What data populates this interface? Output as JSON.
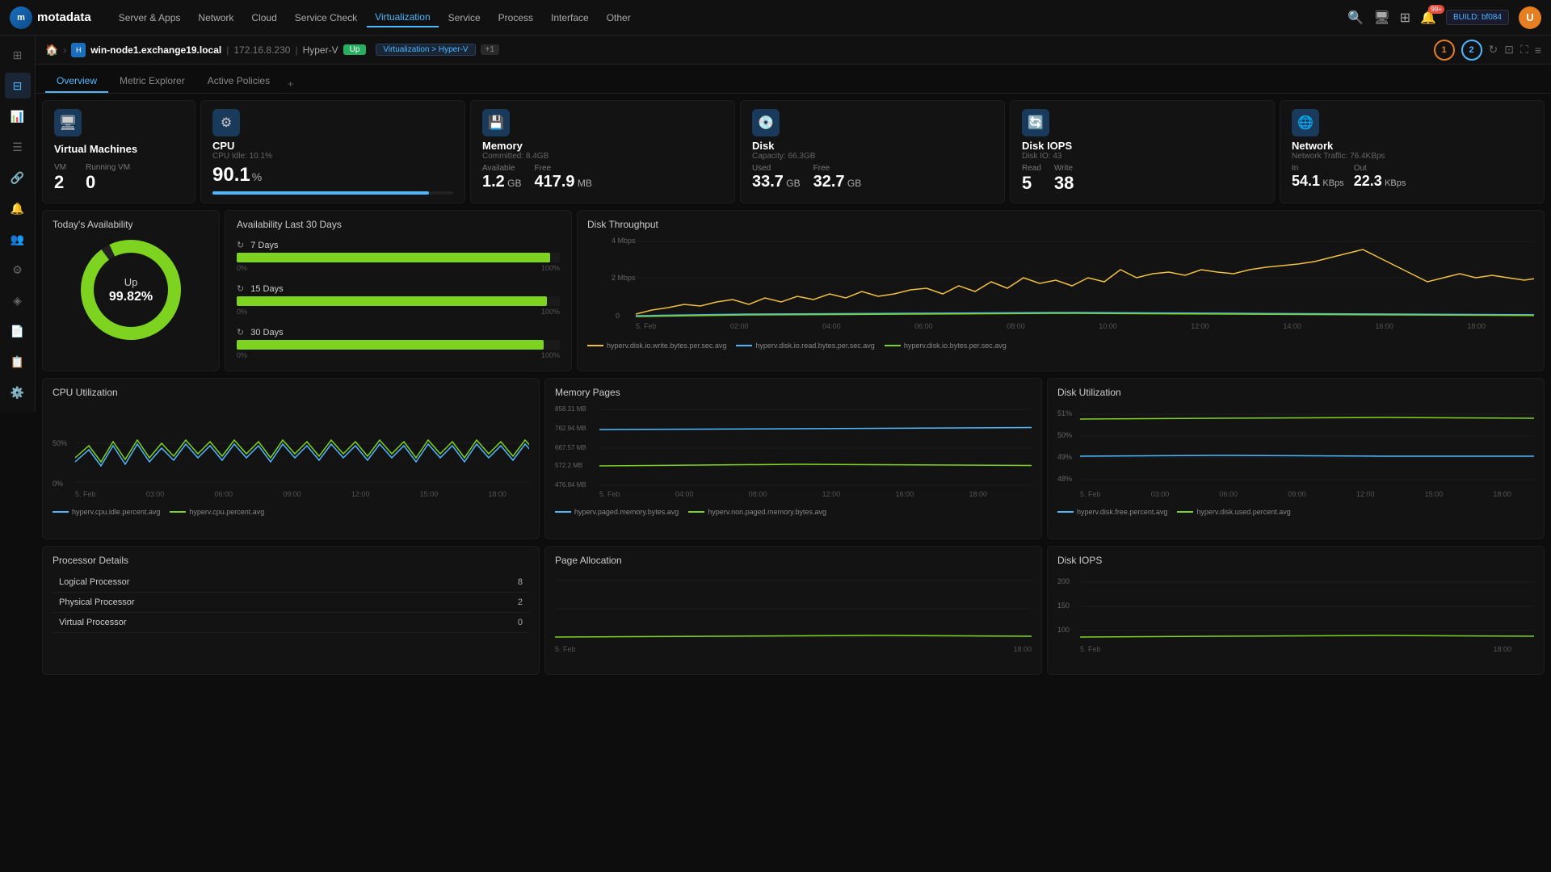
{
  "app": {
    "logo_text": "motadata",
    "build_label": "BUILD: bf084"
  },
  "top_nav": {
    "items": [
      {
        "label": "Server & Apps",
        "active": false
      },
      {
        "label": "Network",
        "active": false
      },
      {
        "label": "Cloud",
        "active": false
      },
      {
        "label": "Service Check",
        "active": false
      },
      {
        "label": "Virtualization",
        "active": true
      },
      {
        "label": "Service",
        "active": false
      },
      {
        "label": "Process",
        "active": false
      },
      {
        "label": "Interface",
        "active": false
      },
      {
        "label": "Other",
        "active": false
      }
    ]
  },
  "breadcrumb": {
    "host": "win-node1.exchange19.local",
    "ip": "172.16.8.230",
    "type": "Hyper-V",
    "status": "Up",
    "virt_tag": "Virtualization > Hyper-V",
    "plus": "+1"
  },
  "tabs": {
    "items": [
      {
        "label": "Overview",
        "active": true
      },
      {
        "label": "Metric Explorer",
        "active": false
      },
      {
        "label": "Active Policies",
        "active": false
      }
    ],
    "add_label": "+"
  },
  "cards": {
    "vm": {
      "title": "Virtual Machines",
      "vm_label": "VM",
      "vm_value": "2",
      "running_label": "Running VM",
      "running_value": "0"
    },
    "cpu": {
      "title": "CPU",
      "subtitle": "CPU Idle: 10.1%",
      "value": "90.1",
      "unit": "%",
      "bar_percent": 90
    },
    "memory": {
      "title": "Memory",
      "subtitle": "Committed: 8.4GB",
      "avail_label": "Available",
      "avail_value": "1.2",
      "avail_unit": "GB",
      "free_label": "Free",
      "free_value": "417.9",
      "free_unit": "MB"
    },
    "disk": {
      "title": "Disk",
      "subtitle": "Capacity: 66.3GB",
      "used_label": "Used",
      "used_value": "33.7",
      "used_unit": "GB",
      "free_label": "Free",
      "free_value": "32.7",
      "free_unit": "GB"
    },
    "disk_iops": {
      "title": "Disk IOPS",
      "subtitle": "Disk IO: 43",
      "read_label": "Read",
      "read_value": "5",
      "write_label": "Write",
      "write_value": "38"
    },
    "network": {
      "title": "Network",
      "subtitle": "Network Traffic: 76.4KBps",
      "in_label": "In",
      "in_value": "54.1",
      "in_unit": "KBps",
      "out_label": "Out",
      "out_value": "22.3",
      "out_unit": "KBps"
    }
  },
  "availability": {
    "today_title": "Today's Availability",
    "status": "Up",
    "percent": "99.82%",
    "last30_title": "Availability Last 30 Days",
    "rows": [
      {
        "label": "7 Days",
        "percent": 97
      },
      {
        "label": "15 Days",
        "percent": 96
      },
      {
        "label": "30 Days",
        "percent": 95
      }
    ]
  },
  "disk_throughput": {
    "title": "Disk Throughput",
    "y_labels": [
      "4 Mbps",
      "2 Mbps",
      "0"
    ],
    "x_labels": [
      "5. Feb",
      "02:00",
      "04:00",
      "06:00",
      "08:00",
      "10:00",
      "12:00",
      "14:00",
      "16:00",
      "18:00"
    ],
    "legend": [
      {
        "label": "hyperv.disk.io.write.bytes.per.sec.avg",
        "color": "#f0c040"
      },
      {
        "label": "hyperv.disk.io.read.bytes.per.sec.avg",
        "color": "#4db8ff"
      },
      {
        "label": "hyperv.disk.io.bytes.per.sec.avg",
        "color": "#7ed321"
      }
    ]
  },
  "cpu_util_chart": {
    "title": "CPU Utilization",
    "y_label": "50%",
    "y_label_low": "0%",
    "x_labels": [
      "5. Feb",
      "03:00",
      "06:00",
      "09:00",
      "12:00",
      "15:00",
      "18:00"
    ],
    "legend": [
      {
        "label": "hyperv.cpu.idle.percent.avg",
        "color": "#4db8ff"
      },
      {
        "label": "hyperv.cpu.percent.avg",
        "color": "#7ed321"
      }
    ]
  },
  "memory_pages_chart": {
    "title": "Memory Pages",
    "y_labels": [
      "858.31 MB",
      "762.94 MB",
      "667.57 MB",
      "572.2 MB",
      "476.84 MB"
    ],
    "x_labels": [
      "5. Feb",
      "04:00",
      "08:00",
      "12:00",
      "16:00",
      "18:00"
    ],
    "legend": [
      {
        "label": "hyperv.paged.memory.bytes.avg",
        "color": "#4db8ff"
      },
      {
        "label": "hyperv.non.paged.memory.bytes.avg",
        "color": "#7ed321"
      }
    ]
  },
  "disk_util_chart": {
    "title": "Disk Utilization",
    "y_labels": [
      "51%",
      "50%",
      "49%",
      "48%"
    ],
    "x_labels": [
      "5. Feb",
      "03:00",
      "06:00",
      "09:00",
      "12:00",
      "15:00",
      "18:00"
    ],
    "legend": [
      {
        "label": "hyperv.disk.free.percent.avg",
        "color": "#4db8ff"
      },
      {
        "label": "hyperv.disk.used.percent.avg",
        "color": "#7ed321"
      }
    ]
  },
  "processor_details": {
    "title": "Processor Details",
    "rows": [
      {
        "label": "Logical Processor",
        "value": "8"
      },
      {
        "label": "Physical Processor",
        "value": "2"
      },
      {
        "label": "Virtual Processor",
        "value": "0"
      }
    ]
  },
  "page_allocation": {
    "title": "Page Allocation"
  },
  "disk_iops_chart": {
    "title": "Disk IOPS",
    "y_labels": [
      "200",
      "150",
      "100"
    ]
  },
  "notification_count": "99+"
}
